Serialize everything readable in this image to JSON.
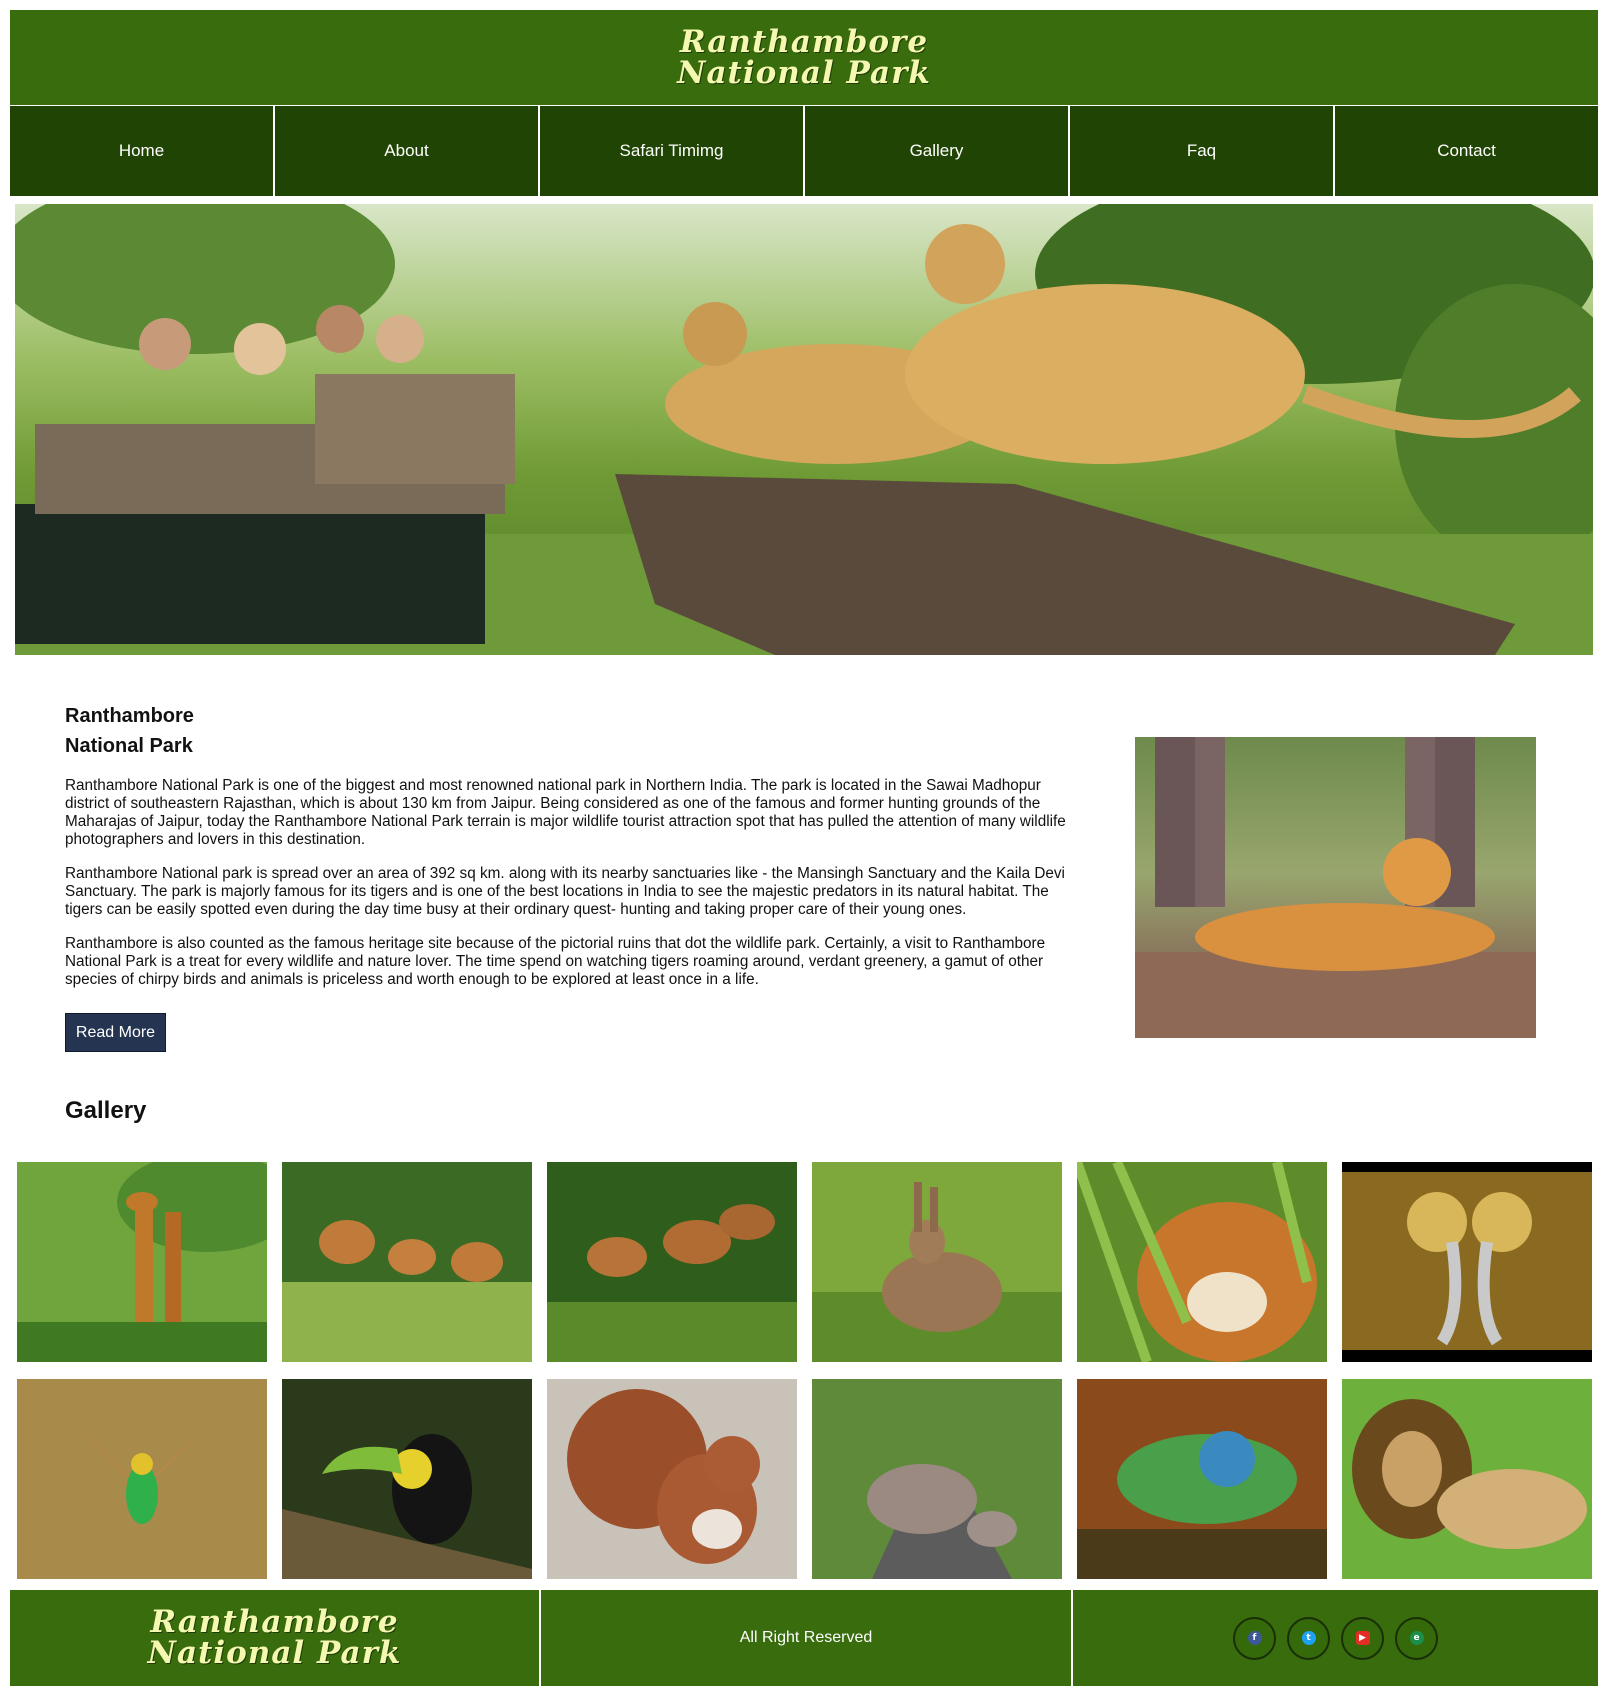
{
  "header": {
    "logo_line1": "Ranthambore",
    "logo_line2": "National Park"
  },
  "nav": {
    "items": [
      "Home",
      "About",
      "Safari Timimg",
      "Gallery",
      "Faq",
      "Contact"
    ]
  },
  "about": {
    "title_line1": "Ranthambore",
    "title_line2": "National Park",
    "paragraphs": [
      "Ranthambore National Park is one of the biggest and most renowned national park in Northern India. The park is located in the Sawai Madhopur district of southeastern Rajasthan, which is about 130 km from Jaipur. Being considered as one of the famous and former hunting grounds of the Maharajas of Jaipur, today the Ranthambore National Park terrain is major wildlife tourist attraction spot that has pulled the attention of many wildlife photographers and lovers in this destination.",
      "Ranthambore National park is spread over an area of 392 sq km. along with its nearby sanctuaries like - the Mansingh Sanctuary and the Kaila Devi Sanctuary. The park is majorly famous for its tigers and is one of the best locations in India to see the majestic predators in its natural habitat. The tigers can be easily spotted even during the day time busy at their ordinary quest- hunting and taking proper care of their young ones.",
      "Ranthambore is also counted as the famous heritage site because of the pictorial ruins that dot the wildlife park. Certainly, a visit to Ranthambore National Park is a treat for every wildlife and nature lover. The time spend on watching tigers roaming around, verdant greenery, a gamut of other species of chirpy birds and animals is priceless and worth enough to be explored at least once in a life."
    ],
    "read_more": "Read More"
  },
  "gallery": {
    "title": "Gallery",
    "images": [
      "giraffes",
      "deer",
      "spotted-deer",
      "hare",
      "tiger",
      "crowned-cranes",
      "bee-eater",
      "toucan",
      "squirrel",
      "elephants",
      "iguana",
      "lion"
    ]
  },
  "footer": {
    "logo_line1": "Ranthambore",
    "logo_line2": "National Park",
    "copyright": "All Right Reserved",
    "social": [
      {
        "name": "facebook-icon",
        "glyph": "f",
        "color": "#3b5998"
      },
      {
        "name": "twitter-icon",
        "glyph": "t",
        "color": "#1da1f2"
      },
      {
        "name": "youtube-icon",
        "glyph": "▶",
        "color": "#e52d27"
      },
      {
        "name": "google-icon",
        "glyph": "e",
        "color": "#1b8f4a"
      }
    ]
  },
  "colors": {
    "header_green": "#386c0d",
    "nav_dark_green": "#1f4403",
    "logo_yellow": "#f4f8b0",
    "button_navy": "#253451"
  }
}
